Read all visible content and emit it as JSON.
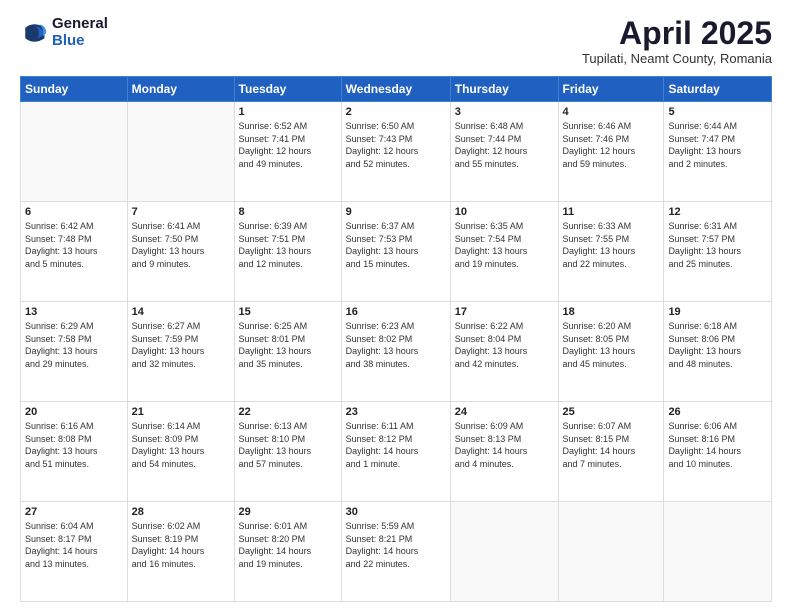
{
  "logo": {
    "general": "General",
    "blue": "Blue"
  },
  "title": {
    "month": "April 2025",
    "location": "Tupilati, Neamt County, Romania"
  },
  "weekdays": [
    "Sunday",
    "Monday",
    "Tuesday",
    "Wednesday",
    "Thursday",
    "Friday",
    "Saturday"
  ],
  "weeks": [
    [
      {
        "day": "",
        "detail": ""
      },
      {
        "day": "",
        "detail": ""
      },
      {
        "day": "1",
        "detail": "Sunrise: 6:52 AM\nSunset: 7:41 PM\nDaylight: 12 hours\nand 49 minutes."
      },
      {
        "day": "2",
        "detail": "Sunrise: 6:50 AM\nSunset: 7:43 PM\nDaylight: 12 hours\nand 52 minutes."
      },
      {
        "day": "3",
        "detail": "Sunrise: 6:48 AM\nSunset: 7:44 PM\nDaylight: 12 hours\nand 55 minutes."
      },
      {
        "day": "4",
        "detail": "Sunrise: 6:46 AM\nSunset: 7:46 PM\nDaylight: 12 hours\nand 59 minutes."
      },
      {
        "day": "5",
        "detail": "Sunrise: 6:44 AM\nSunset: 7:47 PM\nDaylight: 13 hours\nand 2 minutes."
      }
    ],
    [
      {
        "day": "6",
        "detail": "Sunrise: 6:42 AM\nSunset: 7:48 PM\nDaylight: 13 hours\nand 5 minutes."
      },
      {
        "day": "7",
        "detail": "Sunrise: 6:41 AM\nSunset: 7:50 PM\nDaylight: 13 hours\nand 9 minutes."
      },
      {
        "day": "8",
        "detail": "Sunrise: 6:39 AM\nSunset: 7:51 PM\nDaylight: 13 hours\nand 12 minutes."
      },
      {
        "day": "9",
        "detail": "Sunrise: 6:37 AM\nSunset: 7:53 PM\nDaylight: 13 hours\nand 15 minutes."
      },
      {
        "day": "10",
        "detail": "Sunrise: 6:35 AM\nSunset: 7:54 PM\nDaylight: 13 hours\nand 19 minutes."
      },
      {
        "day": "11",
        "detail": "Sunrise: 6:33 AM\nSunset: 7:55 PM\nDaylight: 13 hours\nand 22 minutes."
      },
      {
        "day": "12",
        "detail": "Sunrise: 6:31 AM\nSunset: 7:57 PM\nDaylight: 13 hours\nand 25 minutes."
      }
    ],
    [
      {
        "day": "13",
        "detail": "Sunrise: 6:29 AM\nSunset: 7:58 PM\nDaylight: 13 hours\nand 29 minutes."
      },
      {
        "day": "14",
        "detail": "Sunrise: 6:27 AM\nSunset: 7:59 PM\nDaylight: 13 hours\nand 32 minutes."
      },
      {
        "day": "15",
        "detail": "Sunrise: 6:25 AM\nSunset: 8:01 PM\nDaylight: 13 hours\nand 35 minutes."
      },
      {
        "day": "16",
        "detail": "Sunrise: 6:23 AM\nSunset: 8:02 PM\nDaylight: 13 hours\nand 38 minutes."
      },
      {
        "day": "17",
        "detail": "Sunrise: 6:22 AM\nSunset: 8:04 PM\nDaylight: 13 hours\nand 42 minutes."
      },
      {
        "day": "18",
        "detail": "Sunrise: 6:20 AM\nSunset: 8:05 PM\nDaylight: 13 hours\nand 45 minutes."
      },
      {
        "day": "19",
        "detail": "Sunrise: 6:18 AM\nSunset: 8:06 PM\nDaylight: 13 hours\nand 48 minutes."
      }
    ],
    [
      {
        "day": "20",
        "detail": "Sunrise: 6:16 AM\nSunset: 8:08 PM\nDaylight: 13 hours\nand 51 minutes."
      },
      {
        "day": "21",
        "detail": "Sunrise: 6:14 AM\nSunset: 8:09 PM\nDaylight: 13 hours\nand 54 minutes."
      },
      {
        "day": "22",
        "detail": "Sunrise: 6:13 AM\nSunset: 8:10 PM\nDaylight: 13 hours\nand 57 minutes."
      },
      {
        "day": "23",
        "detail": "Sunrise: 6:11 AM\nSunset: 8:12 PM\nDaylight: 14 hours\nand 1 minute."
      },
      {
        "day": "24",
        "detail": "Sunrise: 6:09 AM\nSunset: 8:13 PM\nDaylight: 14 hours\nand 4 minutes."
      },
      {
        "day": "25",
        "detail": "Sunrise: 6:07 AM\nSunset: 8:15 PM\nDaylight: 14 hours\nand 7 minutes."
      },
      {
        "day": "26",
        "detail": "Sunrise: 6:06 AM\nSunset: 8:16 PM\nDaylight: 14 hours\nand 10 minutes."
      }
    ],
    [
      {
        "day": "27",
        "detail": "Sunrise: 6:04 AM\nSunset: 8:17 PM\nDaylight: 14 hours\nand 13 minutes."
      },
      {
        "day": "28",
        "detail": "Sunrise: 6:02 AM\nSunset: 8:19 PM\nDaylight: 14 hours\nand 16 minutes."
      },
      {
        "day": "29",
        "detail": "Sunrise: 6:01 AM\nSunset: 8:20 PM\nDaylight: 14 hours\nand 19 minutes."
      },
      {
        "day": "30",
        "detail": "Sunrise: 5:59 AM\nSunset: 8:21 PM\nDaylight: 14 hours\nand 22 minutes."
      },
      {
        "day": "",
        "detail": ""
      },
      {
        "day": "",
        "detail": ""
      },
      {
        "day": "",
        "detail": ""
      }
    ]
  ]
}
